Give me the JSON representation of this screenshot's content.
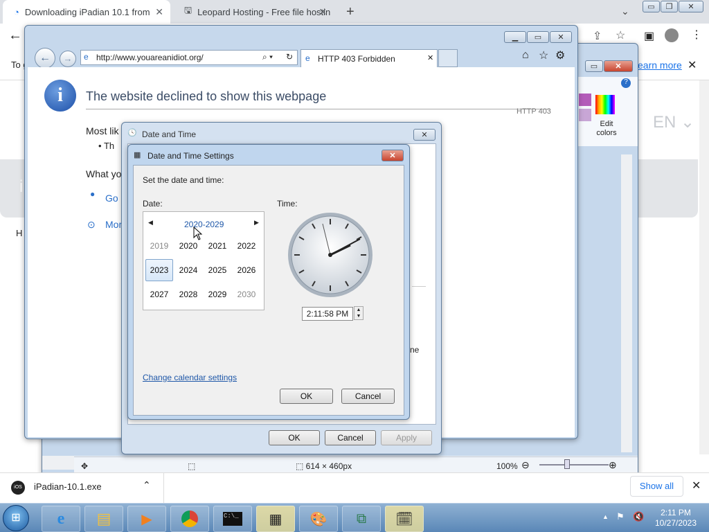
{
  "chrome": {
    "tab1": "Downloading iPadian 10.1 from ",
    "tab2": "Leopard Hosting - Free file hostin",
    "info_left": "To g",
    "learn_more": "earn more",
    "lang": "EN",
    "page_left": "H"
  },
  "ie": {
    "url": "http://www.youareanidiot.org/",
    "tab": "HTTP 403 Forbidden",
    "heading": "The website declined to show this webpage",
    "code": "HTTP 403",
    "most": "Most lik",
    "bullet": "Th",
    "what": "What yo",
    "go": "Go",
    "more": "Mor"
  },
  "paint": {
    "edit": "Edit",
    "colors": "colors",
    "size": "614 × 460px",
    "zoom": "100%"
  },
  "dt": {
    "title": "Date and Time",
    "ok": "OK",
    "cancel": "Cancel",
    "apply": "Apply",
    "partial": "ne"
  },
  "dts": {
    "title": "Date and Time Settings",
    "prompt": "Set the date and time:",
    "date_label": "Date:",
    "time_label": "Time:",
    "decade": "2020-2029",
    "years": [
      [
        "2019",
        "2020",
        "2021",
        "2022"
      ],
      [
        "2023",
        "2024",
        "2025",
        "2026"
      ],
      [
        "2027",
        "2028",
        "2029",
        "2030"
      ]
    ],
    "time_value": "2:11:58 PM",
    "link": "Change calendar settings",
    "ok": "OK",
    "cancel": "Cancel"
  },
  "download": {
    "file": "iPadian-10.1.exe",
    "show_all": "Show all"
  },
  "taskbar": {
    "time": "2:11 PM",
    "date": "10/27/2023"
  }
}
